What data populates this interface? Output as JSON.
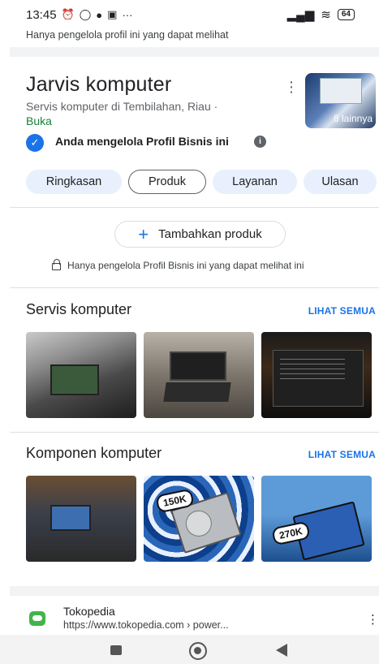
{
  "status_bar": {
    "time": "13:45",
    "notification_icons": [
      "alarm-icon",
      "whatsapp-icon",
      "app-icon",
      "camera-icon"
    ],
    "more": "···",
    "battery": "64"
  },
  "top_note": "Hanya pengelola profil ini yang dapat melihat",
  "business": {
    "name": "Jarvis komputer",
    "subtitle": "Servis komputer di Tembilahan, Riau ·",
    "status": "Buka",
    "photos_more": "8 lainnya",
    "manage_text": "Anda mengelola Profil Bisnis ini"
  },
  "tabs": [
    "Ringkasan",
    "Produk",
    "Layanan",
    "Ulasan"
  ],
  "active_tab": "Produk",
  "products": {
    "add_button": "Tambahkan produk",
    "owner_note": "Hanya pengelola Profil Bisnis ini yang dapat melihat ini"
  },
  "sections": [
    {
      "title": "Servis komputer",
      "see_all": "LIHAT SEMUA"
    },
    {
      "title": "Komponen komputer",
      "see_all": "LIHAT SEMUA"
    }
  ],
  "price_tags": [
    "150K",
    "270K"
  ],
  "search_result": {
    "name": "Tokopedia",
    "url": "https://www.tokopedia.com › power..."
  },
  "colors": {
    "accent": "#1a73e8",
    "open_status": "#188038",
    "chip_background": "#e8f0fe"
  }
}
